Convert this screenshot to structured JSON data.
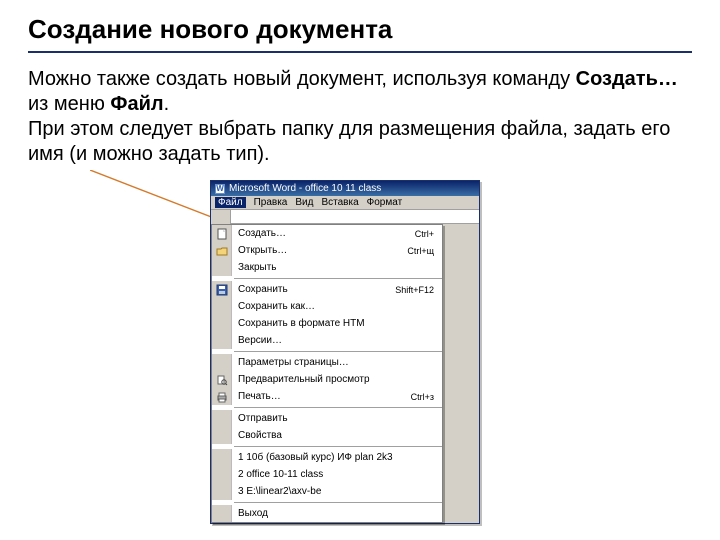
{
  "title": "Создание нового документа",
  "paragraph": {
    "line1a": "Можно также создать новый документ, используя команду ",
    "bold1": "Создать…",
    "line1b": " из меню ",
    "bold2": "Файл",
    "line1c": ".",
    "line2": "При этом следует выбрать папку для размещения файла, задать его имя (и можно задать тип)."
  },
  "window": {
    "app_title": "Microsoft Word - office 10 11 class",
    "menus": [
      "Файл",
      "Правка",
      "Вид",
      "Вставка",
      "Формат"
    ]
  },
  "file_menu": {
    "items": [
      {
        "icon": "new-icon",
        "label": "Создать…",
        "accel": "Ctrl+"
      },
      {
        "icon": "open-icon",
        "label": "Открыть…",
        "accel": "Ctrl+щ"
      },
      {
        "icon": "",
        "label": "Закрыть",
        "accel": ""
      }
    ],
    "items2": [
      {
        "icon": "save-icon",
        "label": "Сохранить",
        "accel": "Shift+F12"
      },
      {
        "icon": "",
        "label": "Сохранить как…",
        "accel": ""
      },
      {
        "icon": "",
        "label": "Сохранить в формате HTM",
        "accel": ""
      },
      {
        "icon": "",
        "label": "Версии…",
        "accel": ""
      }
    ],
    "items3": [
      {
        "icon": "",
        "label": "Параметры страницы…",
        "accel": ""
      },
      {
        "icon": "preview-icon",
        "label": "Предварительный просмотр",
        "accel": ""
      },
      {
        "icon": "print-icon",
        "label": "Печать…",
        "accel": "Ctrl+з"
      }
    ],
    "items4": [
      {
        "icon": "",
        "label": "Отправить",
        "accel": ""
      },
      {
        "icon": "",
        "label": "Свойства",
        "accel": ""
      }
    ],
    "recent": [
      "1 10б (базовый курс) ИФ plan 2k3",
      "2 office 10-11 class",
      "3 E:\\linear2\\axv-be"
    ],
    "exit": "Выход"
  }
}
